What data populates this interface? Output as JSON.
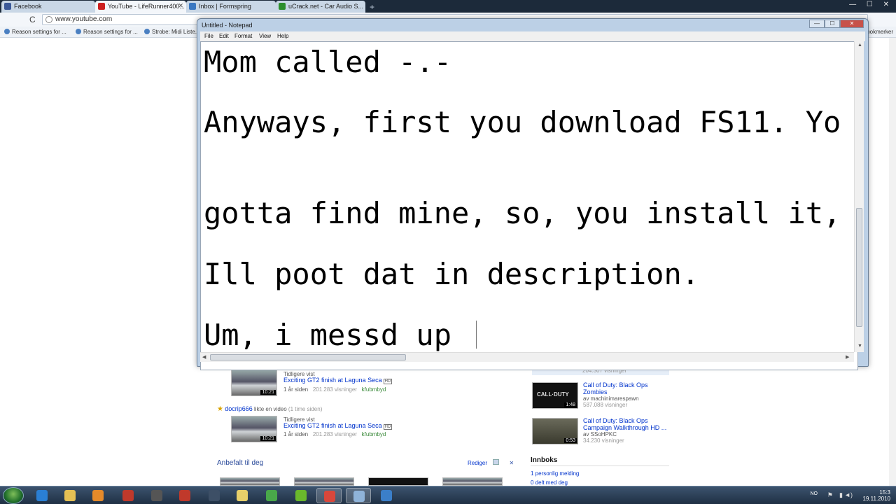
{
  "browser": {
    "tabs": [
      {
        "label": "Facebook",
        "color": "#3b5998"
      },
      {
        "label": "YouTube - LifeRunner400...",
        "color": "#cc1f1f"
      },
      {
        "label": "Inbox | Formspring",
        "color": "#3a78c2"
      },
      {
        "label": "uCrack.net - Car Audio S...",
        "color": "#2d8f2d"
      }
    ],
    "new_tab": "+",
    "window_controls": "— ☐ ✕",
    "reload": "C",
    "address": "www.youtube.com",
    "bookmarks": [
      "Reason settings for ...",
      "Reason settings for ...",
      "Strobe: Midi Liste..."
    ],
    "bookmarks_right": "Andre bokmerker"
  },
  "youtube": {
    "feed": [
      {
        "context": "Tidligere vist",
        "title": "Exciting GT2 finish at Laguna Seca",
        "meta": "1 år siden",
        "views": "201.283 visninger",
        "author": "kfubmbyd",
        "duration": "10:21"
      },
      {
        "liker": "docrip666",
        "liked_text": "likte en video",
        "when": "(1 time siden)",
        "context": "Tidligere vist",
        "title": "Exciting GT2 finish at Laguna Seca",
        "meta": "1 år siden",
        "views": "201.283 visninger",
        "author": "kfubmbyd",
        "duration": "10:21"
      }
    ],
    "recommended": {
      "heading": "Anbefalt til deg",
      "action": "Rediger"
    },
    "sidebar": [
      {
        "views": "204.307 visninger"
      },
      {
        "title": "Call of Duty: Black Ops Zombies",
        "author": "av machinimarespawn",
        "views": "587.088 visninger",
        "duration": "1:48",
        "thumb_text": "CALL·DUTY"
      },
      {
        "title": "Call of Duty: Black Ops Campaign Walkthrough HD ...",
        "author": "av SSoHPKC",
        "views": "34.230 visninger",
        "duration": "0:53"
      }
    ],
    "inbox": {
      "heading": "Innboks",
      "items": [
        "1 personlig melding",
        "0 delt med deg"
      ]
    }
  },
  "notepad": {
    "title": "Untitled - Notepad",
    "menu": [
      "File",
      "Edit",
      "Format",
      "View",
      "Help"
    ],
    "lines": [
      "Mom called -.-",
      "Anyways, first you download FS11. Yo",
      "gotta find mine, so, you install it,",
      "Ill poot dat in description.",
      "Um, i messd up "
    ],
    "controls": {
      "min": "—",
      "max": "☐",
      "close": "✕"
    }
  },
  "taskbar": {
    "language": "NO",
    "time": "15:3",
    "date": "19.11.2010",
    "apps": [
      {
        "name": "ie-icon",
        "color": "#2a7fd4"
      },
      {
        "name": "explorer-icon",
        "color": "#e5c054"
      },
      {
        "name": "media-player-icon",
        "color": "#e58a2a"
      },
      {
        "name": "app-red-icon",
        "color": "#c0392b"
      },
      {
        "name": "game-controller-icon",
        "color": "#555555"
      },
      {
        "name": "acrobat-icon",
        "color": "#c0392b"
      },
      {
        "name": "steam-icon",
        "color": "#3d4f66"
      },
      {
        "name": "folder-icon",
        "color": "#e7cf6a"
      },
      {
        "name": "messenger-icon",
        "color": "#49a84a"
      },
      {
        "name": "spotify-icon",
        "color": "#6ab82c"
      },
      {
        "name": "chrome-icon",
        "color": "#d9473b"
      },
      {
        "name": "notepad-icon",
        "color": "#8fb3d9"
      },
      {
        "name": "apps-icon",
        "color": "#3b7fc9"
      }
    ]
  }
}
